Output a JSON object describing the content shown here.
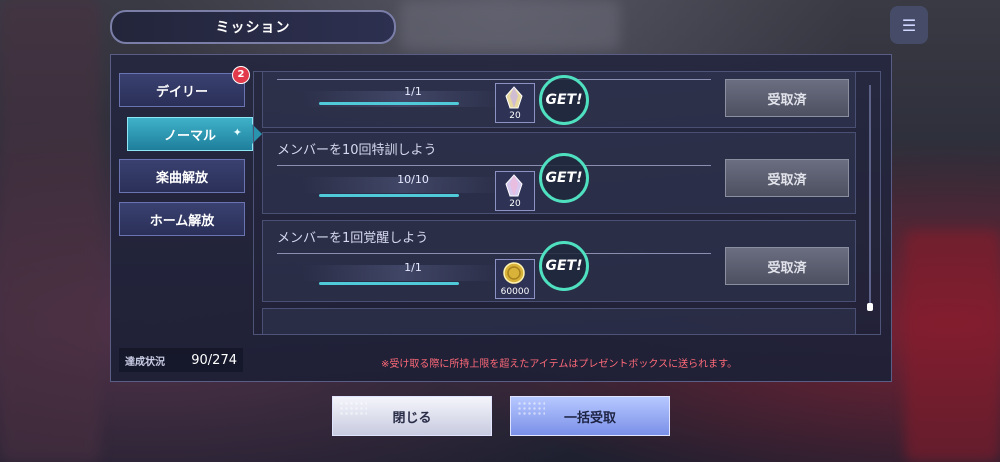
{
  "header": {
    "title": "ミッション"
  },
  "sidebar": {
    "items": [
      {
        "label": "デイリー",
        "badge": "2"
      },
      {
        "label": "ノーマル",
        "active": true
      },
      {
        "label": "楽曲解放"
      },
      {
        "label": "ホーム解放"
      }
    ]
  },
  "missions": [
    {
      "title": "",
      "progress_text": "1/1",
      "progress": 1.0,
      "reward_icon": "crystal-icon",
      "reward_qty": "20",
      "get_label": "GET!",
      "claim_label": "受取済"
    },
    {
      "title": "メンバーを10回特訓しよう",
      "progress_text": "10/10",
      "progress": 1.0,
      "reward_icon": "crystal-icon",
      "reward_qty": "20",
      "get_label": "GET!",
      "claim_label": "受取済"
    },
    {
      "title": "メンバーを1回覚醒しよう",
      "progress_text": "1/1",
      "progress": 1.0,
      "reward_icon": "coin-icon",
      "reward_qty": "60000",
      "get_label": "GET!",
      "claim_label": "受取済"
    }
  ],
  "stats": {
    "label": "達成状況",
    "value": "90/274"
  },
  "notice": "※受け取る際に所持上限を超えたアイテムはプレゼントボックスに送られます。",
  "buttons": {
    "close": "閉じる",
    "claim_all": "一括受取"
  },
  "colors": {
    "accent": "#50c9d8",
    "get_ring": "#4fe0c0",
    "notice": "#ff6a78"
  }
}
